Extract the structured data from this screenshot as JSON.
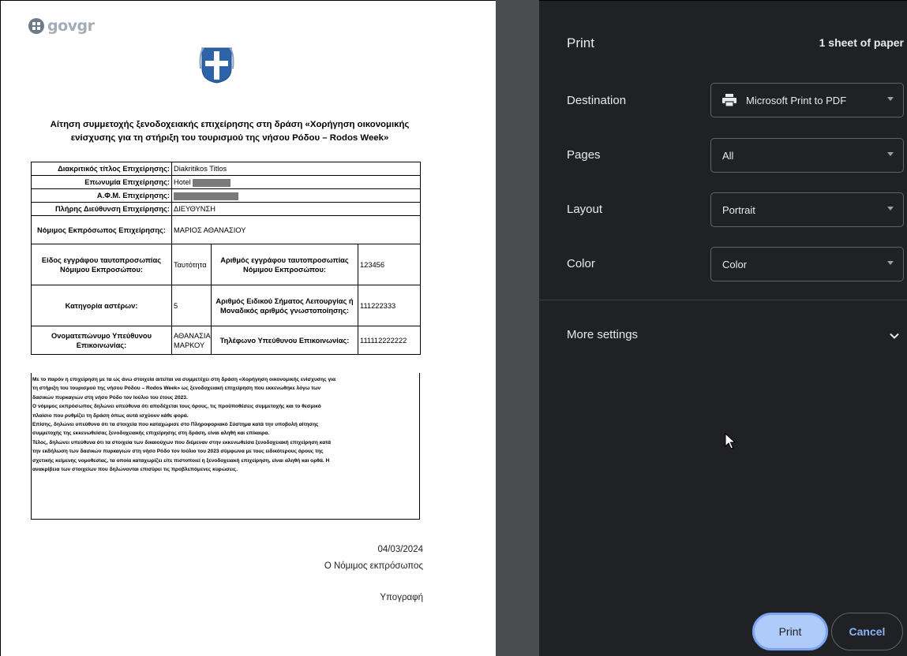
{
  "preview": {
    "logo_text": "govgr",
    "title_line1": "Αίτηση συμμετοχής ξενοδοχειακής επιχείρησης στη δράση «Χορήγηση οικονομικής",
    "title_line2": "ενίσχυσης για τη στήριξη του τουρισμού της νήσου Ρόδου – Rodos Week»",
    "table": {
      "r1_label": "Διακριτικός τίτλος Επιχείρησης:",
      "r1_value": "Diakritikos Titlos",
      "r2_label": "Επωνυμία Επιχείρησης:",
      "r2_value": "Hotel",
      "r3_label": "Α.Φ.Μ. Επιχείρησης:",
      "r4_label": "Πλήρης Διεύθυνση Επιχείρησης:",
      "r4_value": "ΔΙΕΥΘΥΝΣΗ",
      "r5_label": "Νόμιμος Εκπρόσωπος Επιχείρησης:",
      "r5_value": "ΜΑΡΙΟΣ ΑΘΑΝΑΣΙΟΥ",
      "r6_label_a": "Είδος εγγράφου ταυτοπροσωπίας Νόμιμου Εκπροσώπου:",
      "r6_value_a": "Ταυτότητα",
      "r6_label_b": "Αριθμός εγγράφου ταυτοπροσωπίας Νόμιμου Εκπροσώπου:",
      "r6_value_b": "123456",
      "r7_label_a": "Κατηγορία αστέρων:",
      "r7_value_a": "5",
      "r7_label_b": "Αριθμός Ειδικού Σήματος Λειτουργίας ή Μοναδικός αριθμός γνωστοποίησης:",
      "r7_value_b": "111222333",
      "r8_label_a": "Ονοματεπώνυμο Υπεύθυνου Επικοινωνίας:",
      "r8_value_a": "ΑΘΑΝΑΣΙΑ ΜΑΡΚΟΥ",
      "r8_label_b": "Τηλέφωνο Υπεύθυνου Επικοινωνίας:",
      "r8_value_b": "111112222222"
    },
    "declaration": [
      "Με το παρόν η επιχείρηση με τα ως άνω στοιχεία αιτείται να συμμετέχει στη δράση «Χορήγηση οικονομικής ενίσχυσης για",
      "τη στήριξη του τουρισμού της νήσου Ρόδου – Rodos Week» ως ξενοδοχειακή επιχείρηση που εκκενώθηκε λόγω των",
      "δασικών πυρκαγιών στη νήσο Ρόδο τον Ιούλιο του έτους 2023.",
      "Ο νόμιμος εκπρόσωπος δηλώνει υπεύθυνα ότι αποδέχεται τους όρους, τις προϋποθέσεις συμμετοχής και το θεσμικό",
      "πλαίσιο που ρυθμίζει τη δράση όπως αυτά ισχύουν κάθε φορά.",
      "Επίσης, δηλώνει υπεύθυνα ότι τα στοιχεία που καταχώρισε στο Πληροφοριακό Σύστημα κατά την υποβολή αίτησης",
      "συμμετοχής της εκκενωθείσας ξενοδοχειακής επιχείρησης στη δράση, είναι αληθή και επίκαιρα.",
      "Τέλος, δηλώνει υπεύθυνα ότι τα στοιχεία των δικαιούχων που διέμεναν στην εκκενωθείσα ξενοδοχειακή επιχείρηση κατά",
      "την εκδήλωση των δασικών πυρκαγιών στη νήσο Ρόδο τον Ιούλιο του 2023 σύμφωνα με τους ειδικότερους όρους της",
      "σχετικής κείμενης νομοθεσίας, τα οποία καταχωρίζει είτε πιστοποιεί η ξενοδοχειακή επιχείρηση, είναι αληθή και ορθά. Η",
      "ανακρίβεια των στοιχείων που δηλώνονται επισύρει τις προβλεπόμενες κυρώσεις."
    ],
    "date": "04/03/2024",
    "role": "Ο Νόμιμος εκπρόσωπος",
    "signature": "Υπογραφή"
  },
  "panel": {
    "title": "Print",
    "sheets": "1 sheet of paper",
    "destination_label": "Destination",
    "destination_value": "Microsoft Print to PDF",
    "pages_label": "Pages",
    "pages_value": "All",
    "layout_label": "Layout",
    "layout_value": "Portrait",
    "color_label": "Color",
    "color_value": "Color",
    "more_settings": "More settings",
    "print_button": "Print",
    "cancel_button": "Cancel"
  },
  "colors": {
    "panel_bg": "#202124",
    "gutter_bg": "#4a4c50",
    "print_button_bg": "#aecbfa",
    "accent_text": "#8ab4f8"
  },
  "icons": [
    "greek-emblem-icon",
    "printer-icon",
    "caret-down-icon",
    "chevron-down-icon",
    "mouse-cursor-icon"
  ]
}
